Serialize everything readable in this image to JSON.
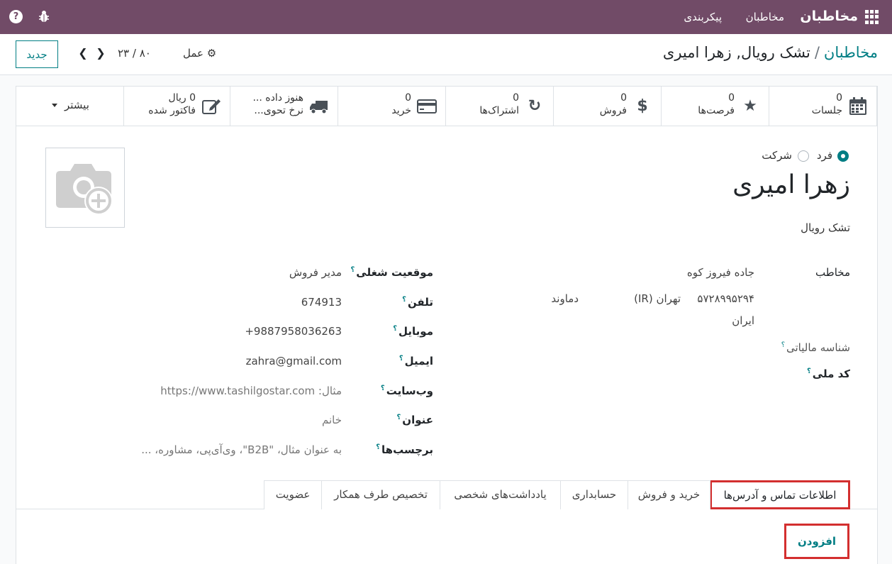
{
  "navbar": {
    "app_name": "مخاطبان",
    "menu_contacts": "مخاطبان",
    "menu_config": "پیکربندی",
    "help_glyph": "?"
  },
  "control_panel": {
    "breadcrumb_parent": "مخاطبان",
    "breadcrumb_separator": "/",
    "breadcrumb_current": "تشک رویال, زهرا امیری",
    "new_button": "جدید",
    "action_label": "عمل",
    "pager": "۲۳ / ۸۰"
  },
  "stat_buttons": [
    {
      "value": "0",
      "label": "جلسات",
      "icon": "calendar-icon"
    },
    {
      "value": "0",
      "label": "فرصت‌ها",
      "icon": "star-icon"
    },
    {
      "value": "0",
      "label": "فروش",
      "icon": "dollar-icon"
    },
    {
      "value": "0",
      "label": "اشتراک‌ها",
      "icon": "refresh-icon"
    },
    {
      "value": "0",
      "label": "خرید",
      "icon": "credit-card-icon"
    },
    {
      "value": "هنوز داده ...",
      "label": "نرخ تحوی...",
      "icon": "truck-icon"
    },
    {
      "value": "0 ریال",
      "label": "فاکتور شده",
      "icon": "edit-icon"
    }
  ],
  "more_button": "بیشتر",
  "company_type": {
    "person": "فرد",
    "company": "شرکت",
    "selected": "person"
  },
  "partner": {
    "name": "زهرا امیری",
    "parent_company": "تشک رویال"
  },
  "address": {
    "label": "مخاطب",
    "street": "جاده فیروز کوه",
    "city": "دماوند",
    "state": "تهران (IR)",
    "zip": "۵۷۲۸۹۹۵۲۹۴",
    "country": "ایران"
  },
  "left_fields": {
    "tax_id_label": "شناسه مالیاتی",
    "national_code_label": "کد ملی",
    "help": "؟"
  },
  "right_fields": [
    {
      "label": "موقعیت شغلی",
      "value": "مدیر فروش"
    },
    {
      "label": "تلفن",
      "value": "674913"
    },
    {
      "label": "موبایل",
      "value": "+9887958036263"
    },
    {
      "label": "ایمیل",
      "value": "zahra@gmail.com"
    },
    {
      "label": "وب‌سایت",
      "value": "مثال: https://www.tashilgostar.com"
    },
    {
      "label": "عنوان",
      "value": "خانم"
    },
    {
      "label": "برچسب‌ها",
      "value": "به عنوان مثال، \"B2B\"، وی‌آی‌پی، مشاوره، ..."
    }
  ],
  "tabs": [
    "اطلاعات تماس و آدرس‌ها",
    "خرید و فروش",
    "حسابداری",
    "یادداشت‌های شخصی",
    "تخصیص طرف همکار",
    "عضویت"
  ],
  "add_button": "افزودن"
}
